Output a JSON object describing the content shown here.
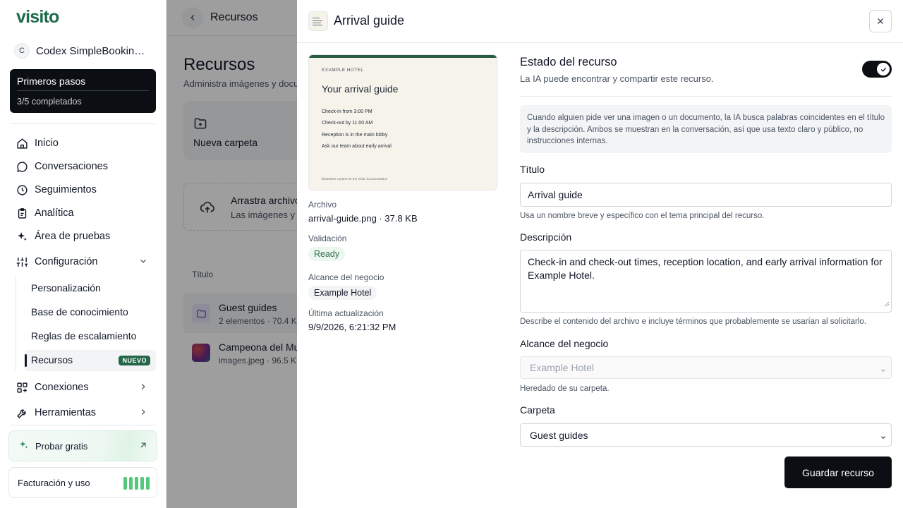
{
  "sidebar": {
    "logo": "visito",
    "workspace": {
      "initial": "C",
      "name": "Codex SimpleBooking..."
    },
    "onboarding": {
      "title": "Primeros pasos",
      "progress": "3/5 completados"
    },
    "nav": [
      {
        "label": "Inicio",
        "icon": "home-icon"
      },
      {
        "label": "Conversaciones",
        "icon": "chat-icon"
      },
      {
        "label": "Seguimientos",
        "icon": "clock-icon"
      },
      {
        "label": "Analítica",
        "icon": "clipboard-icon"
      },
      {
        "label": "Área de pruebas",
        "icon": "sparkles-icon"
      },
      {
        "label": "Configuración",
        "icon": "sliders-icon"
      }
    ],
    "config_items": [
      "Personalización",
      "Base de conocimiento",
      "Reglas de escalamiento",
      "Recursos"
    ],
    "new_badge": "NUEVO",
    "connections": "Conexiones",
    "tools": "Herramientas",
    "try_free": "Probar gratis",
    "billing": "Facturación y uso"
  },
  "background": {
    "breadcrumb": "Recursos",
    "title": "Recursos",
    "description": "Administra imágenes y docu",
    "new_folder": "Nueva carpeta",
    "drop_title": "Arrastra archivo",
    "drop_sub": "Las imágenes y l",
    "table_header": "Título",
    "rows": [
      {
        "name": "Guest guides",
        "meta": "2 elementos · 70.4 KB"
      },
      {
        "name": "Campeona del Mu",
        "meta": "images.jpeg · 96.5 KB"
      }
    ]
  },
  "panel": {
    "title": "Arrival guide",
    "preview": {
      "org": "EXAMPLE HOTEL",
      "heading": "Your arrival guide",
      "lines": [
        "Check-in from 3:00 PM",
        "Check-out by 11:00 AM",
        "Reception is in the main lobby",
        "Ask our team about early arrival"
      ],
      "footer": "Illustrative content for the Visito documentation"
    },
    "meta": {
      "file_label": "Archivo",
      "file_value": "arrival-guide.png · 37.8 KB",
      "validation_label": "Validación",
      "validation_value": "Ready",
      "scope_label": "Alcance del negocio",
      "scope_value": "Example Hotel",
      "updated_label": "Última actualización",
      "updated_value": "9/9/2026, 6:21:32 PM"
    },
    "status": {
      "title": "Estado del recurso",
      "subtitle": "La IA puede encontrar y compartir este recurso.",
      "enabled": true
    },
    "info": "Cuando alguien pide ver una imagen o un documento, la IA busca palabras coincidentes en el título y la descripción. Ambos se muestran en la conversación, así que usa texto claro y público, no instrucciones internas.",
    "form": {
      "title_label": "Título",
      "title_value": "Arrival guide",
      "title_help": "Usa un nombre breve y específico con el tema principal del recurso.",
      "desc_label": "Descripción",
      "desc_value": "Check-in and check-out times, reception location, and early arrival information for Example Hotel.",
      "desc_help": "Describe el contenido del archivo e incluye términos que probablemente se usarían al solicitarlo.",
      "scope_label": "Alcance del negocio",
      "scope_value": "Example Hotel",
      "scope_help": "Heredado de su carpeta.",
      "folder_label": "Carpeta",
      "folder_value": "Guest guides"
    },
    "save_label": "Guardar recurso"
  },
  "colors": {
    "brand": "#1f6b49",
    "accent_dark": "#0b0f14",
    "ready": "#2d6a4f"
  }
}
